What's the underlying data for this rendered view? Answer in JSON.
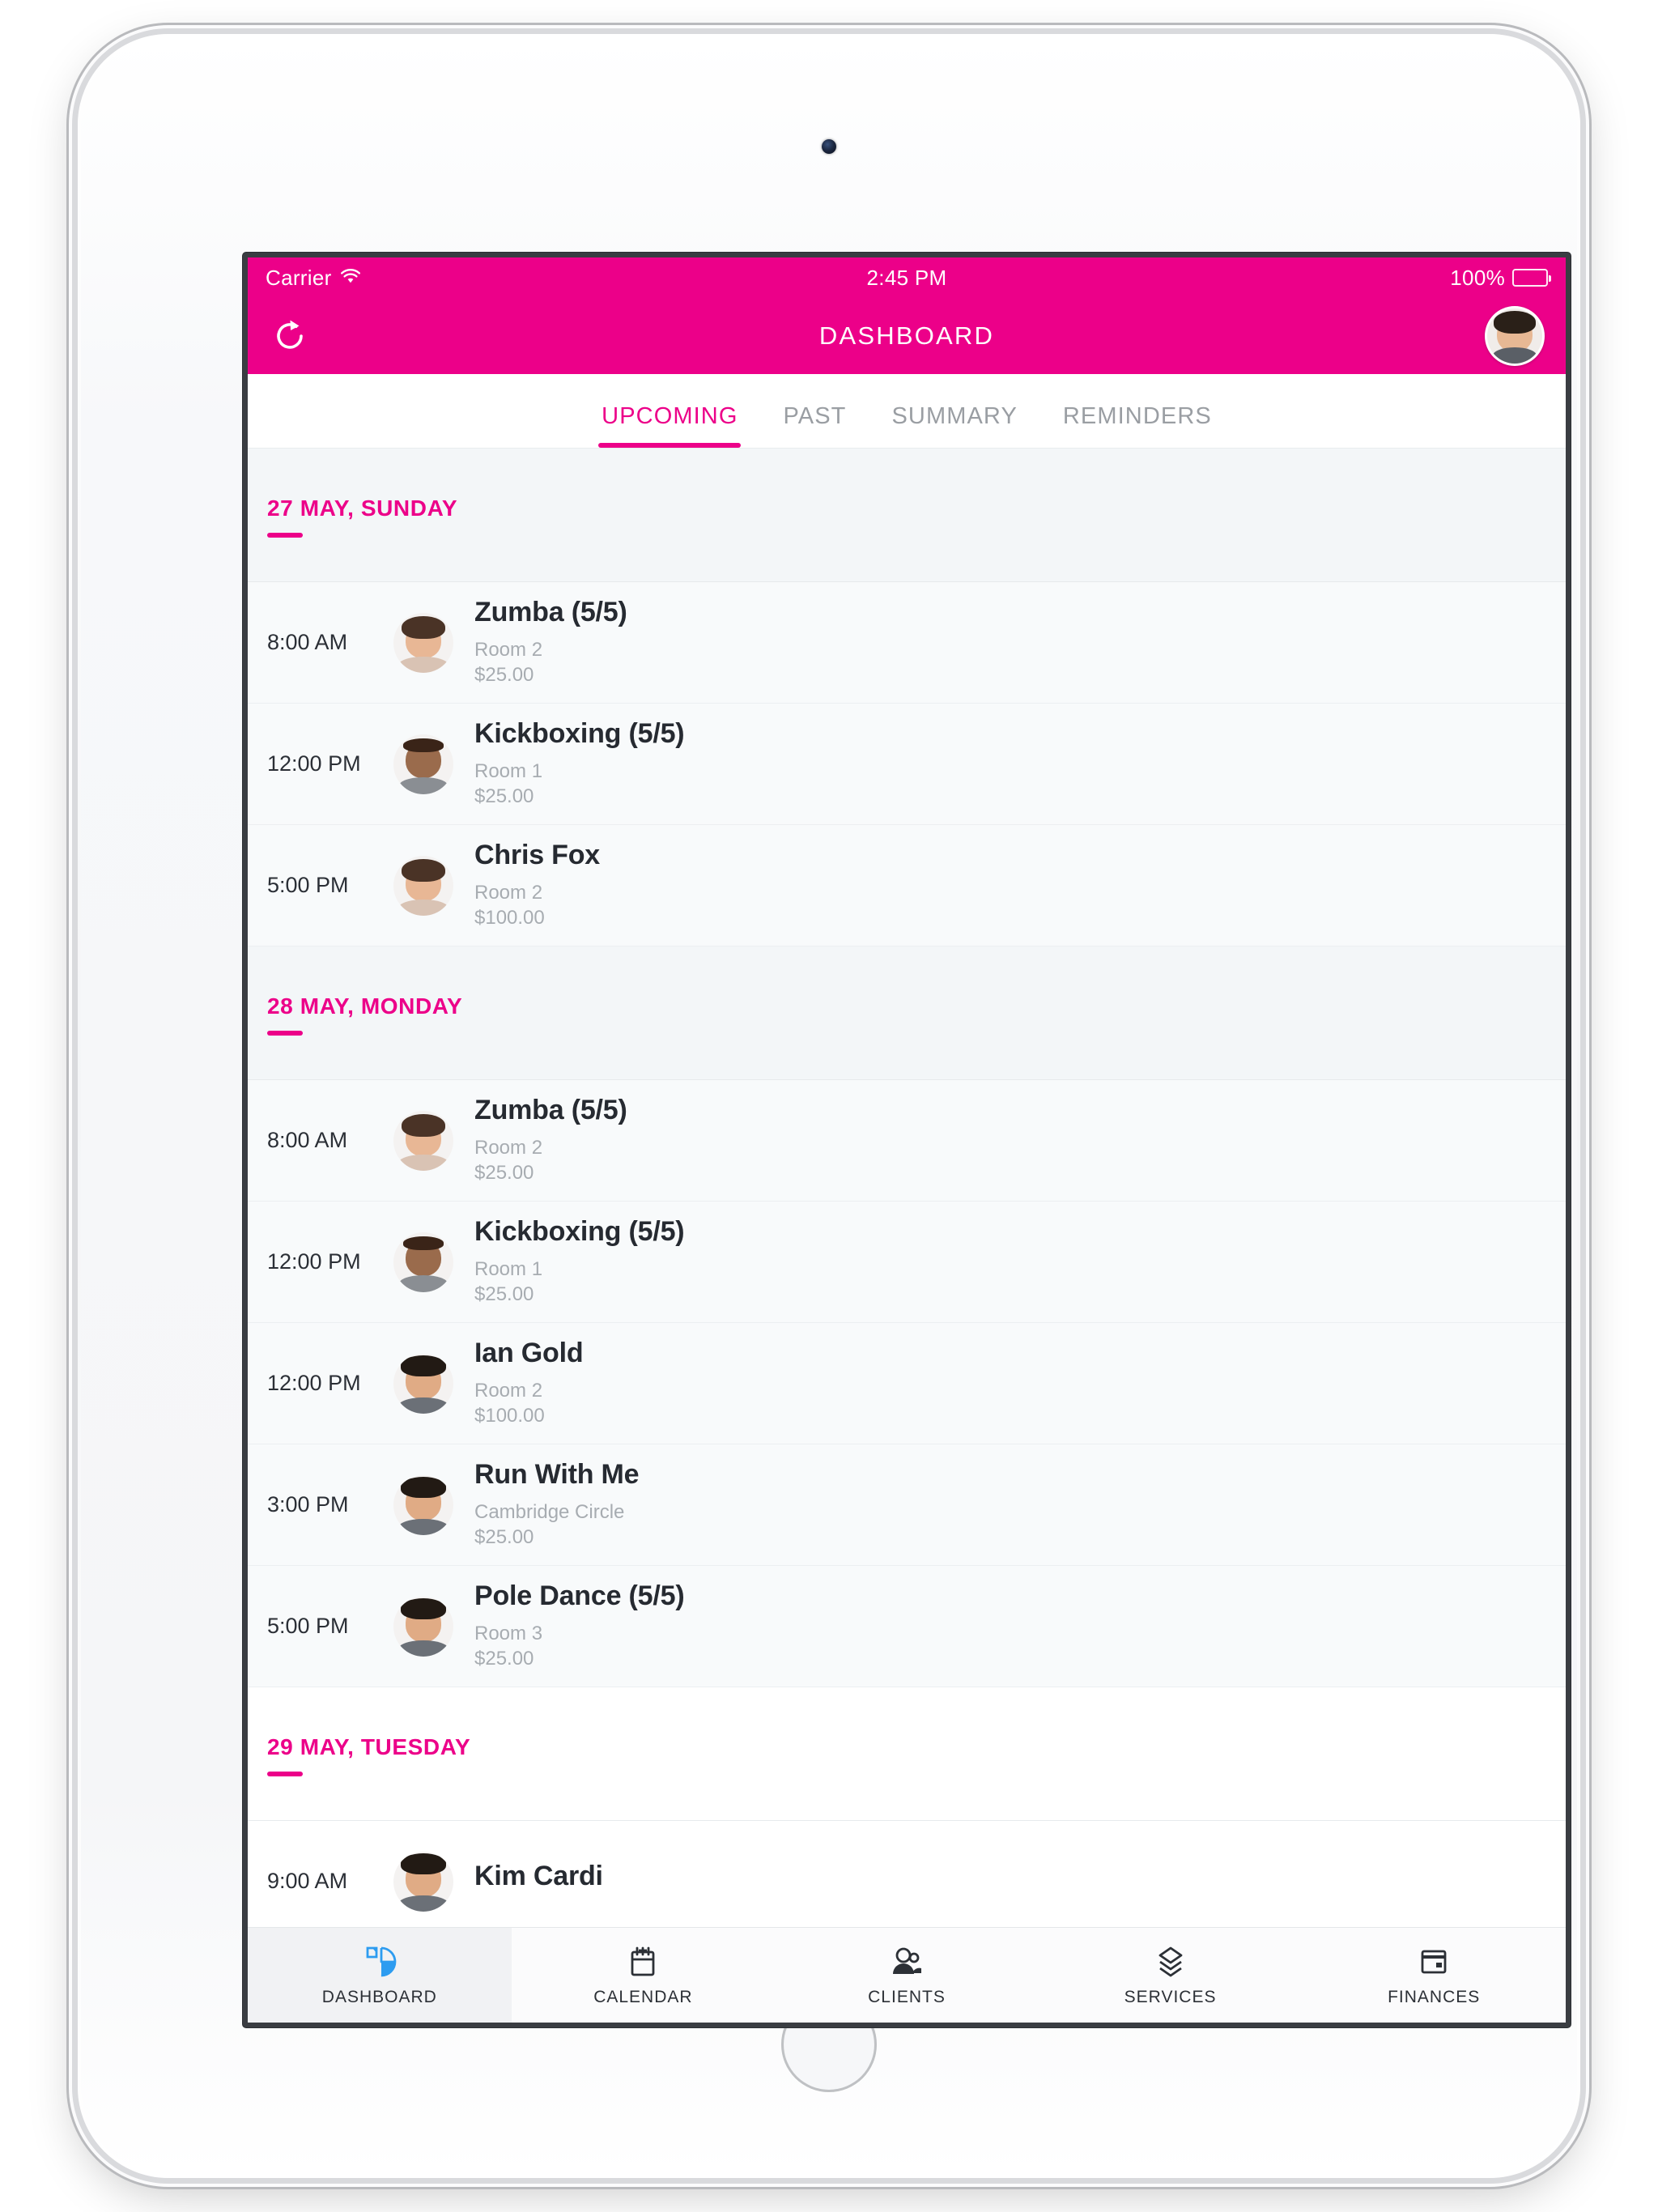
{
  "status_bar": {
    "carrier": "Carrier",
    "wifi_icon": "wifi-icon",
    "time": "2:45 PM",
    "battery_percent": "100%",
    "battery_icon": "battery-full-icon"
  },
  "nav_bar": {
    "refresh_icon": "refresh-icon",
    "title": "DASHBOARD",
    "avatar_icon": "user-avatar"
  },
  "tabs": [
    {
      "label": "UPCOMING",
      "active": true
    },
    {
      "label": "PAST",
      "active": false
    },
    {
      "label": "SUMMARY",
      "active": false
    },
    {
      "label": "REMINDERS",
      "active": false
    }
  ],
  "days": [
    {
      "date_label": "27 MAY, SUNDAY",
      "appointments": [
        {
          "time": "8:00 AM",
          "title": "Zumba (5/5)",
          "location": "Room 2",
          "price": "$25.00",
          "avatar": "woman-brown-hair"
        },
        {
          "time": "12:00 PM",
          "title": "Kickboxing (5/5)",
          "location": "Room 1",
          "price": "$25.00",
          "avatar": "man-bald-beard"
        },
        {
          "time": "5:00 PM",
          "title": "Chris Fox",
          "location": "Room 2",
          "price": "$100.00",
          "avatar": "woman-brown-hair"
        }
      ]
    },
    {
      "date_label": "28 MAY, MONDAY",
      "appointments": [
        {
          "time": "8:00 AM",
          "title": "Zumba (5/5)",
          "location": "Room 2",
          "price": "$25.00",
          "avatar": "woman-brown-hair"
        },
        {
          "time": "12:00 PM",
          "title": "Kickboxing (5/5)",
          "location": "Room 1",
          "price": "$25.00",
          "avatar": "man-bald-beard"
        },
        {
          "time": "12:00 PM",
          "title": "Ian Gold",
          "location": "Room 2",
          "price": "$100.00",
          "avatar": "man-dark-hair"
        },
        {
          "time": "3:00 PM",
          "title": "Run With Me",
          "location": "Cambridge Circle",
          "price": "$25.00",
          "avatar": "man-dark-hair"
        },
        {
          "time": "5:00 PM",
          "title": "Pole Dance (5/5)",
          "location": "Room 3",
          "price": "$25.00",
          "avatar": "man-dark-hair"
        }
      ]
    },
    {
      "date_label": "29 MAY, TUESDAY",
      "appointments": [
        {
          "time": "9:00 AM",
          "title": "Kim Cardi",
          "location": "",
          "price": "",
          "avatar": "man-dark-hair"
        }
      ]
    }
  ],
  "bottom_nav": [
    {
      "label": "DASHBOARD",
      "icon": "pie-chart-icon",
      "active": true
    },
    {
      "label": "CALENDAR",
      "icon": "calendar-icon",
      "active": false
    },
    {
      "label": "CLIENTS",
      "icon": "people-icon",
      "active": false
    },
    {
      "label": "SERVICES",
      "icon": "layers-icon",
      "active": false
    },
    {
      "label": "FINANCES",
      "icon": "credit-card-icon",
      "active": false
    }
  ],
  "colors": {
    "accent_pink": "#ec0089",
    "active_tab_blue": "#2d9cf0",
    "row_background": "#f8fafb",
    "day_header_background": "#f3f6f8",
    "muted_text": "#a7acb1"
  }
}
